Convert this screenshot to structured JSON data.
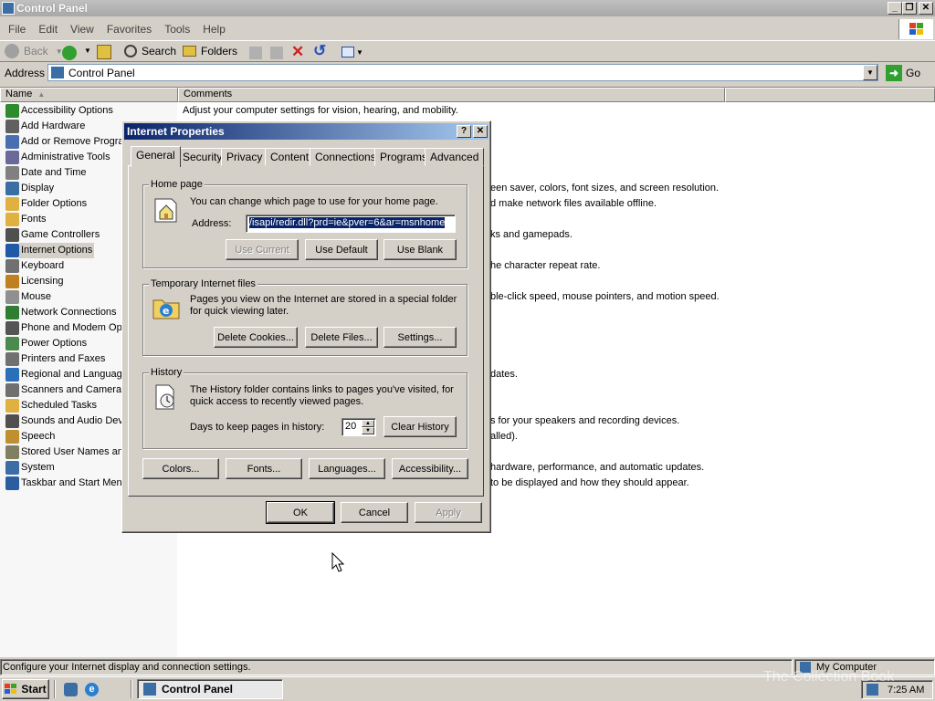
{
  "window": {
    "title": "Control Panel"
  },
  "menu": [
    "File",
    "Edit",
    "View",
    "Favorites",
    "Tools",
    "Help"
  ],
  "toolbar": {
    "back": "Back",
    "search": "Search",
    "folders": "Folders"
  },
  "address": {
    "label": "Address",
    "value": "Control Panel",
    "go": "Go"
  },
  "columns": {
    "name": "Name",
    "comments": "Comments"
  },
  "items": [
    {
      "name": "Accessibility Options",
      "comment": "Adjust your computer settings for vision, hearing, and mobility.",
      "icon": "accessibility-icon",
      "color": "#2e8b2e"
    },
    {
      "name": "Add Hardware",
      "comment": "",
      "icon": "add-hardware-icon",
      "color": "#606060"
    },
    {
      "name": "Add or Remove Programs",
      "comment": "",
      "icon": "add-remove-programs-icon",
      "color": "#4a6fb0"
    },
    {
      "name": "Administrative Tools",
      "comment": "",
      "icon": "administrative-tools-icon",
      "color": "#6a6a9a"
    },
    {
      "name": "Date and Time",
      "comment": "",
      "icon": "clock-icon",
      "color": "#808080"
    },
    {
      "name": "Display",
      "comment": "een saver, colors, font sizes, and screen resolution.",
      "icon": "display-icon",
      "color": "#3a6ea5"
    },
    {
      "name": "Folder Options",
      "comment": "d make network files available offline.",
      "icon": "folder-options-icon",
      "color": "#e0b040"
    },
    {
      "name": "Fonts",
      "comment": "",
      "icon": "fonts-folder-icon",
      "color": "#e0b040"
    },
    {
      "name": "Game Controllers",
      "comment": "ks and gamepads.",
      "icon": "gamepad-icon",
      "color": "#505050"
    },
    {
      "name": "Internet Options",
      "comment": "",
      "icon": "internet-options-icon",
      "color": "#1e5aa8"
    },
    {
      "name": "Keyboard",
      "comment": "he character repeat rate.",
      "icon": "keyboard-icon",
      "color": "#707070"
    },
    {
      "name": "Licensing",
      "comment": "",
      "icon": "licensing-icon",
      "color": "#c08020"
    },
    {
      "name": "Mouse",
      "comment": "ble-click speed, mouse pointers, and motion speed.",
      "icon": "mouse-icon",
      "color": "#909090"
    },
    {
      "name": "Network Connections",
      "comment": "",
      "icon": "network-icon",
      "color": "#2e7d32"
    },
    {
      "name": "Phone and Modem Options",
      "comment": "",
      "icon": "phone-icon",
      "color": "#555555"
    },
    {
      "name": "Power Options",
      "comment": "",
      "icon": "power-icon",
      "color": "#4a8a4a"
    },
    {
      "name": "Printers and Faxes",
      "comment": "",
      "icon": "printer-icon",
      "color": "#707070"
    },
    {
      "name": "Regional and Language Options",
      "comment": "dates.",
      "icon": "globe-icon",
      "color": "#2a6fb8"
    },
    {
      "name": "Scanners and Cameras",
      "comment": "",
      "icon": "scanner-icon",
      "color": "#707070"
    },
    {
      "name": "Scheduled Tasks",
      "comment": "",
      "icon": "scheduled-tasks-icon",
      "color": "#e0b040"
    },
    {
      "name": "Sounds and Audio Devices",
      "comment": "s for your speakers and recording devices.",
      "icon": "speaker-icon",
      "color": "#505050"
    },
    {
      "name": "Speech",
      "comment": "alled).",
      "icon": "speech-icon",
      "color": "#c09030"
    },
    {
      "name": "Stored User Names and Passwords",
      "comment": "",
      "icon": "stored-passwords-icon",
      "color": "#808060"
    },
    {
      "name": "System",
      "comment": "hardware, performance, and automatic updates.",
      "icon": "system-icon",
      "color": "#3a6ea5"
    },
    {
      "name": "Taskbar and Start Menu",
      "comment": "to be displayed and how they should appear.",
      "icon": "taskbar-icon",
      "color": "#2a5ea0"
    }
  ],
  "dialog": {
    "title": "Internet Properties",
    "tabs": [
      "General",
      "Security",
      "Privacy",
      "Content",
      "Connections",
      "Programs",
      "Advanced"
    ],
    "home": {
      "group": "Home page",
      "desc": "You can change which page to use for your home page.",
      "address_label": "Address:",
      "address_value": "/isapi/redir.dll?prd=ie&pver=6&ar=msnhome",
      "use_current": "Use Current",
      "use_default": "Use Default",
      "use_blank": "Use Blank"
    },
    "temp": {
      "group": "Temporary Internet files",
      "desc1": "Pages you view on the Internet are stored in a special folder",
      "desc2": "for quick viewing later.",
      "delete_cookies": "Delete Cookies...",
      "delete_files": "Delete Files...",
      "settings": "Settings..."
    },
    "history": {
      "group": "History",
      "desc1": "The History folder contains links to pages you've visited, for",
      "desc2": "quick access to recently viewed pages.",
      "days_label": "Days to keep pages in history:",
      "days_value": "20",
      "clear": "Clear History"
    },
    "bottom": {
      "colors": "Colors...",
      "fonts": "Fonts...",
      "languages": "Languages...",
      "accessibility": "Accessibility..."
    },
    "ok": "OK",
    "cancel": "Cancel",
    "apply": "Apply"
  },
  "status": {
    "text": "Configure your Internet display and connection settings.",
    "zone": "My Computer"
  },
  "taskbar": {
    "start": "Start",
    "task": "Control Panel",
    "clock": "7:25 AM"
  },
  "watermark": "The Collection Book"
}
